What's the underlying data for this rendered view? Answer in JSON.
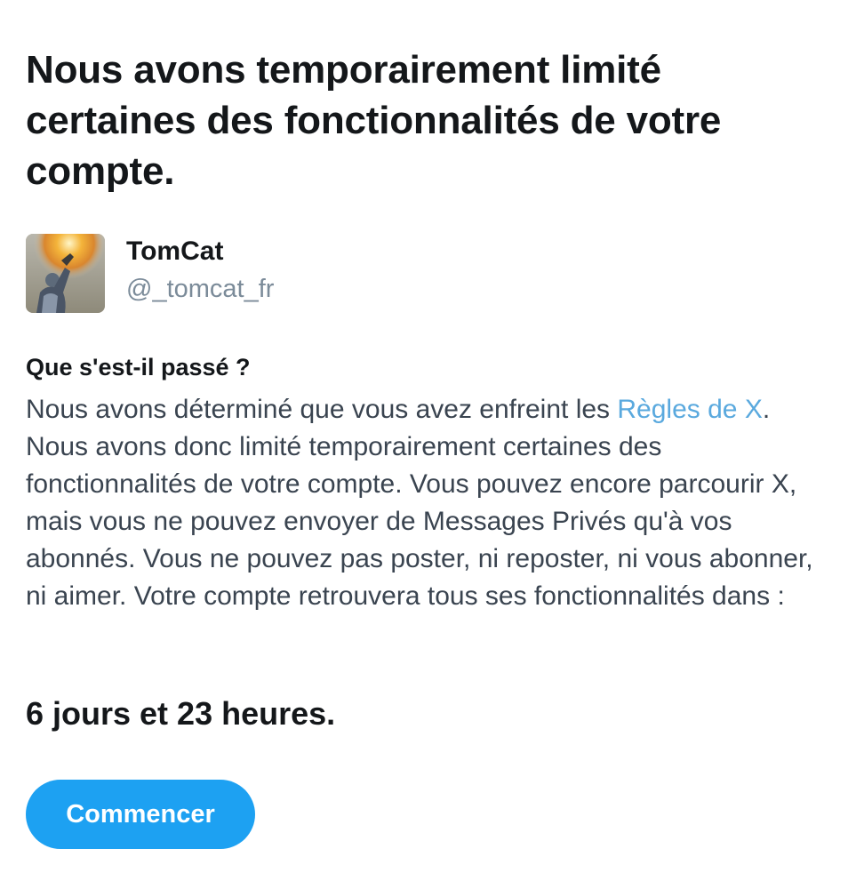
{
  "header": {
    "title": "Nous avons temporairement limité certaines des fonctionnalités de votre compte."
  },
  "account": {
    "display_name": "TomCat",
    "handle": "@_tomcat_fr"
  },
  "info": {
    "heading": "Que s'est-il passé ?",
    "text_before_link": "Nous avons déterminé que vous avez enfreint les ",
    "link_label": "Règles de X",
    "text_after_link": ". Nous avons donc limité temporairement certaines des fonctionnalités de votre compte. Vous pouvez encore parcourir X, mais vous ne pouvez envoyer de Messages Privés qu'à vos abonnés. Vous ne pouvez pas poster, ni reposter, ni vous abonner, ni aimer. Votre compte retrouvera tous ses fonctionnalités dans :"
  },
  "countdown": {
    "remaining": "6 jours et 23 heures."
  },
  "actions": {
    "start_label": "Commencer"
  },
  "colors": {
    "accent": "#1da1f2",
    "link": "#5aa9de",
    "handle": "#7b8b99",
    "heading_text": "#14171a",
    "body_text": "#3a4450"
  }
}
